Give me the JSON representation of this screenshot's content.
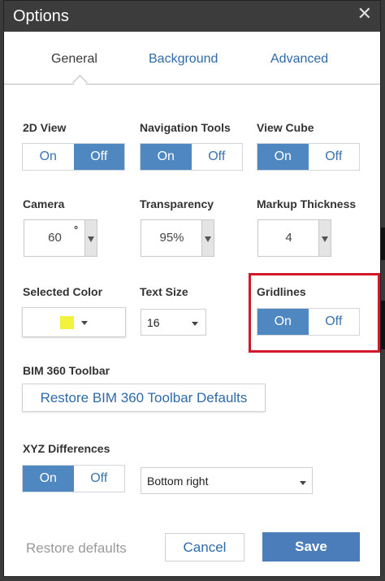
{
  "dialog": {
    "title": "Options",
    "close_glyph": "✕"
  },
  "tabs": [
    {
      "label": "General",
      "active": true
    },
    {
      "label": "Background",
      "active": false
    },
    {
      "label": "Advanced",
      "active": false
    }
  ],
  "toggles": {
    "view_2d": {
      "label": "2D View",
      "on": "On",
      "off": "Off",
      "selected": "Off"
    },
    "navigation_tools": {
      "label": "Navigation Tools",
      "on": "On",
      "off": "Off",
      "selected": "On"
    },
    "view_cube": {
      "label": "View Cube",
      "on": "On",
      "off": "Off",
      "selected": "On"
    },
    "gridlines": {
      "label": "Gridlines",
      "on": "On",
      "off": "Off",
      "selected": "On"
    },
    "xyz_differences": {
      "label": "XYZ Differences",
      "on": "On",
      "off": "Off",
      "selected": "On"
    }
  },
  "spinners": {
    "camera": {
      "label": "Camera",
      "value": "60",
      "unit": "°"
    },
    "transparency": {
      "label": "Transparency",
      "value": "95%"
    },
    "markup_thickness": {
      "label": "Markup Thickness",
      "value": "4"
    }
  },
  "selected_color": {
    "label": "Selected Color",
    "color": "#f2f23c"
  },
  "text_size": {
    "label": "Text Size",
    "value": "16"
  },
  "bim360": {
    "label": "BIM 360 Toolbar",
    "button": "Restore BIM 360 Toolbar Defaults"
  },
  "xyz_position": {
    "value": "Bottom right"
  },
  "footer": {
    "restore": "Restore defaults",
    "cancel": "Cancel",
    "save": "Save"
  },
  "colors": {
    "accent": "#4f87c1",
    "link": "#2f6aa8",
    "highlight_box": "#d3182b",
    "titlebar": "#3c3c3c"
  }
}
